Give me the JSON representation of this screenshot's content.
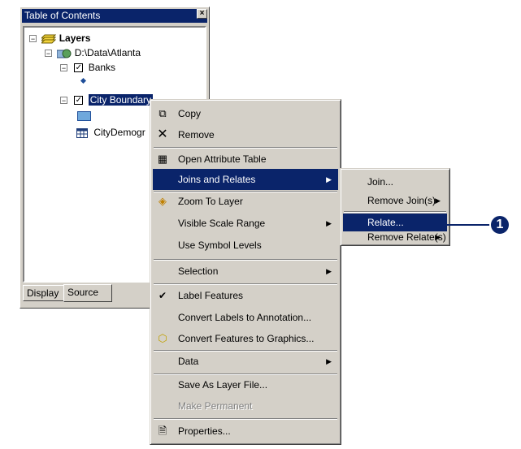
{
  "toc": {
    "title": "Table of Contents",
    "close_glyph": "×",
    "tree": {
      "layers": "Layers",
      "source": "D:\\Data\\Atlanta",
      "banks": "Banks",
      "city_boundary": "City Boundary",
      "city_demog": "CityDemogr"
    },
    "tabs": {
      "display": "Display",
      "source": "Source"
    }
  },
  "context_menu": {
    "items": [
      {
        "label": "Copy",
        "icon": "copy-icon"
      },
      {
        "label": "Remove",
        "icon": "remove-icon"
      },
      {
        "label": "Open Attribute Table",
        "icon": "table-icon"
      },
      {
        "label": "Joins and Relates",
        "submenu": true,
        "highlighted": true
      },
      {
        "label": "Zoom To Layer",
        "icon": "zoom-to-layer-icon"
      },
      {
        "label": "Visible Scale Range",
        "submenu": true
      },
      {
        "label": "Use Symbol Levels"
      },
      {
        "label": "Selection",
        "submenu": true
      },
      {
        "label": "Label Features",
        "checked": true
      },
      {
        "label": "Convert Labels to Annotation..."
      },
      {
        "label": "Convert Features to Graphics...",
        "icon": "convert-graphics-icon"
      },
      {
        "label": "Data",
        "submenu": true
      },
      {
        "label": "Save As Layer File..."
      },
      {
        "label": "Make Permanent",
        "disabled": true
      },
      {
        "label": "Properties...",
        "icon": "properties-icon"
      }
    ]
  },
  "submenu": {
    "items": [
      {
        "label": "Join..."
      },
      {
        "label": "Remove Join(s)",
        "submenu": true
      },
      {
        "label": "Relate...",
        "highlighted": true
      },
      {
        "label": "Remove Relate(s)",
        "submenu": true
      }
    ]
  },
  "callout": {
    "number": "1"
  },
  "colors": {
    "highlight": "#0a246a",
    "menu_bg": "#d4d0c8",
    "polygon_fill": "#6fa8dc"
  }
}
